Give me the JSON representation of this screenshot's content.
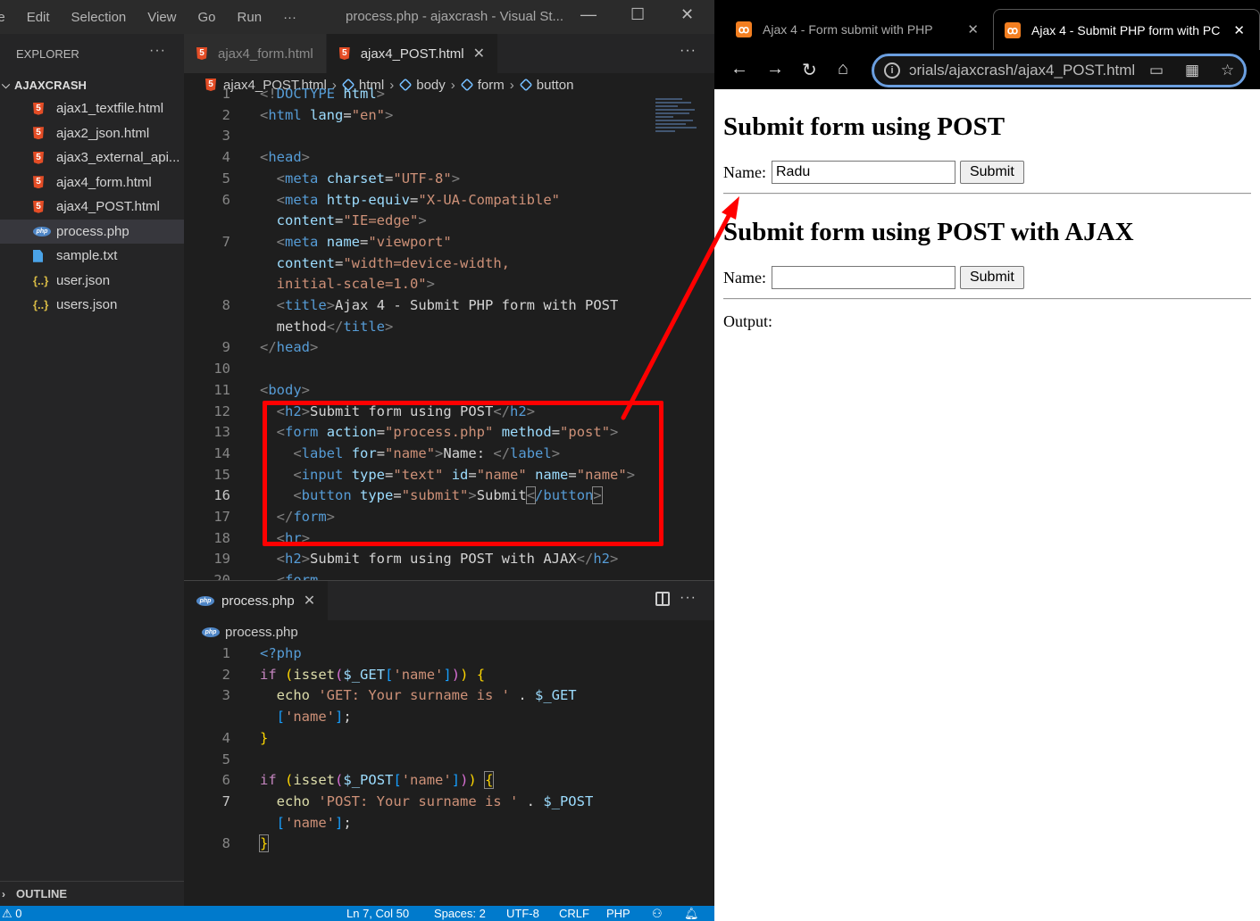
{
  "vscode": {
    "menu": [
      "le",
      "Edit",
      "Selection",
      "View",
      "Go",
      "Run",
      "···"
    ],
    "window_title": "process.php - ajaxcrash - Visual St...",
    "window_controls": {
      "minimize": "—",
      "maximize": "☐",
      "close": "✕"
    },
    "explorer": {
      "header": "EXPLORER",
      "more": "···",
      "project": "AJAXCRASH",
      "files": [
        {
          "name": "ajax1_textfile.html",
          "icon": "html5-icon"
        },
        {
          "name": "ajax2_json.html",
          "icon": "html5-icon"
        },
        {
          "name": "ajax3_external_api...",
          "icon": "html5-icon"
        },
        {
          "name": "ajax4_form.html",
          "icon": "html5-icon"
        },
        {
          "name": "ajax4_POST.html",
          "icon": "html5-icon"
        },
        {
          "name": "process.php",
          "icon": "php-icon",
          "active": true
        },
        {
          "name": "sample.txt",
          "icon": "text-file-icon"
        },
        {
          "name": "user.json",
          "icon": "json-icon"
        },
        {
          "name": "users.json",
          "icon": "json-icon"
        }
      ],
      "outline": "OUTLINE"
    },
    "editor1": {
      "tabs": [
        {
          "label": "ajax4_form.html",
          "active": false
        },
        {
          "label": "ajax4_POST.html",
          "active": true
        }
      ],
      "breadcrumb": [
        "ajax4_POST.html",
        "html",
        "body",
        "form",
        "button"
      ],
      "lines": [
        {
          "n": "1",
          "html": "<span class='t-br'>&lt;!</span><span class='t-tag'>DOCTYPE</span> <span class='t-at'>html</span><span class='t-br'>&gt;</span>"
        },
        {
          "n": "2",
          "html": "<span class='t-br'>&lt;</span><span class='t-tag'>html</span> <span class='t-at'>lang</span>=<span class='t-st'>\"en\"</span><span class='t-br'>&gt;</span>"
        },
        {
          "n": "3",
          "html": ""
        },
        {
          "n": "4",
          "html": "<span class='t-br'>&lt;</span><span class='t-tag'>head</span><span class='t-br'>&gt;</span>"
        },
        {
          "n": "5",
          "html": "  <span class='t-br'>&lt;</span><span class='t-tag'>meta</span> <span class='t-at'>charset</span>=<span class='t-st'>\"UTF-8\"</span><span class='t-br'>&gt;</span>"
        },
        {
          "n": "6",
          "html": "  <span class='t-br'>&lt;</span><span class='t-tag'>meta</span> <span class='t-at'>http-equiv</span>=<span class='t-st'>\"X-UA-Compatible\"</span>"
        },
        {
          "n": "",
          "html": "  <span class='t-at'>content</span>=<span class='t-st'>\"IE=edge\"</span><span class='t-br'>&gt;</span>"
        },
        {
          "n": "7",
          "html": "  <span class='t-br'>&lt;</span><span class='t-tag'>meta</span> <span class='t-at'>name</span>=<span class='t-st'>\"viewport\"</span>"
        },
        {
          "n": "",
          "html": "  <span class='t-at'>content</span>=<span class='t-st'>\"width=device-width,</span>"
        },
        {
          "n": "",
          "html": "  <span class='t-st'>initial-scale=1.0\"</span><span class='t-br'>&gt;</span>"
        },
        {
          "n": "8",
          "html": "  <span class='t-br'>&lt;</span><span class='t-tag'>title</span><span class='t-br'>&gt;</span>Ajax 4 - Submit PHP form with POST"
        },
        {
          "n": "",
          "html": "  method<span class='t-br'>&lt;/</span><span class='t-tag'>title</span><span class='t-br'>&gt;</span>"
        },
        {
          "n": "9",
          "html": "<span class='t-br'>&lt;/</span><span class='t-tag'>head</span><span class='t-br'>&gt;</span>"
        },
        {
          "n": "10",
          "html": ""
        },
        {
          "n": "11",
          "html": "<span class='t-br'>&lt;</span><span class='t-tag'>body</span><span class='t-br'>&gt;</span>"
        },
        {
          "n": "12",
          "html": "  <span class='t-br'>&lt;</span><span class='t-tag'>h2</span><span class='t-br'>&gt;</span>Submit form using POST<span class='t-br'>&lt;/</span><span class='t-tag'>h2</span><span class='t-br'>&gt;</span>"
        },
        {
          "n": "13",
          "html": "  <span class='t-br'>&lt;</span><span class='t-tag'>form</span> <span class='t-at'>action</span>=<span class='t-st'>\"process.php\"</span> <span class='t-at'>method</span>=<span class='t-st'>\"post\"</span><span class='t-br'>&gt;</span>"
        },
        {
          "n": "14",
          "html": "    <span class='t-br'>&lt;</span><span class='t-tag'>label</span> <span class='t-at'>for</span>=<span class='t-st'>\"name\"</span><span class='t-br'>&gt;</span>Name: <span class='t-br'>&lt;/</span><span class='t-tag'>label</span><span class='t-br'>&gt;</span>"
        },
        {
          "n": "15",
          "html": "    <span class='t-br'>&lt;</span><span class='t-tag'>input</span> <span class='t-at'>type</span>=<span class='t-st'>\"text\"</span> <span class='t-at'>id</span>=<span class='t-st'>\"name\"</span> <span class='t-at'>name</span>=<span class='t-st'>\"name\"</span><span class='t-br'>&gt;</span>"
        },
        {
          "n": "16",
          "html": "    <span class='t-br'>&lt;</span><span class='t-tag'>button</span> <span class='t-at'>type</span>=<span class='t-st'>\"submit\"</span><span class='t-br'>&gt;</span>Submit<span class='t-br' style='outline:1px solid #888'>&lt;</span><span class='t-tag'>/button</span><span class='t-br' style='outline:1px solid #888'>&gt;</span>",
          "current": true
        },
        {
          "n": "17",
          "html": "  <span class='t-br'>&lt;/</span><span class='t-tag'>form</span><span class='t-br'>&gt;</span>"
        },
        {
          "n": "18",
          "html": "  <span class='t-br'>&lt;</span><span class='t-tag'>hr</span><span class='t-br'>&gt;</span>"
        },
        {
          "n": "19",
          "html": "  <span class='t-br'>&lt;</span><span class='t-tag'>h2</span><span class='t-br'>&gt;</span>Submit form using POST with AJAX<span class='t-br'>&lt;/</span><span class='t-tag'>h2</span><span class='t-br'>&gt;</span>"
        },
        {
          "n": "20",
          "html": "  <span class='t-br'>&lt;</span><span class='t-tag'>form</span>"
        }
      ]
    },
    "editor2": {
      "tab": "process.php",
      "breadcrumb": "process.php",
      "lines": [
        {
          "n": "1",
          "html": "<span class='t-tag'>&lt;?php</span>"
        },
        {
          "n": "2",
          "html": "<span class='t-kw'>if</span> <span class='t-p1'>(</span><span class='t-fn'>isset</span><span class='t-p2'>(</span><span class='t-var'>$_GET</span><span class='t-p3'>[</span><span class='t-st'>'name'</span><span class='t-p3'>]</span><span class='t-p2'>)</span><span class='t-p1'>)</span> <span class='t-p1'>{</span>"
        },
        {
          "n": "3",
          "html": "  <span class='t-fn'>echo</span> <span class='t-st'>'GET: Your surname is '</span> . <span class='t-var'>$_GET</span>"
        },
        {
          "n": "",
          "html": "  <span class='t-p3'>[</span><span class='t-st'>'name'</span><span class='t-p3'>]</span>;"
        },
        {
          "n": "4",
          "html": "<span class='t-p1'>}</span>"
        },
        {
          "n": "5",
          "html": ""
        },
        {
          "n": "6",
          "html": "<span class='t-kw'>if</span> <span class='t-p1'>(</span><span class='t-fn'>isset</span><span class='t-p2'>(</span><span class='t-var'>$_POST</span><span class='t-p3'>[</span><span class='t-st'>'name'</span><span class='t-p3'>]</span><span class='t-p2'>)</span><span class='t-p1'>)</span> <span class='t-p1' style='outline:1px solid #888'>{</span>"
        },
        {
          "n": "7",
          "html": "  <span class='t-fn'>echo</span> <span class='t-st'>'POST: Your surname is '</span> . <span class='t-var'>$_POST</span>",
          "current": true
        },
        {
          "n": "",
          "html": "  <span class='t-p3'>[</span><span class='t-st'>'name'</span><span class='t-p3'>]</span>;"
        },
        {
          "n": "8",
          "html": "<span class='t-p1' style='outline:1px solid #888'>}</span>"
        }
      ]
    },
    "statusbar": {
      "left": "⚠ 0",
      "position": "Ln 7, Col 50",
      "spaces": "Spaces: 2",
      "encoding": "UTF-8",
      "eol": "CRLF",
      "language": "PHP"
    }
  },
  "browser": {
    "tabs": [
      {
        "title": "Ajax 4 - Form submit with PHP",
        "active": false
      },
      {
        "title": "Ajax 4 - Submit PHP form with PC",
        "active": true
      }
    ],
    "url": "ɔrials/ajaxcrash/ajax4_POST.html",
    "page": {
      "heading1": "Submit form using POST",
      "name_label": "Name:",
      "input1_value": "Radu",
      "submit_label": "Submit",
      "heading2": "Submit form using POST with AJAX",
      "input2_value": "",
      "output_label": "Output:"
    }
  },
  "annotation_color": "#ff0000"
}
